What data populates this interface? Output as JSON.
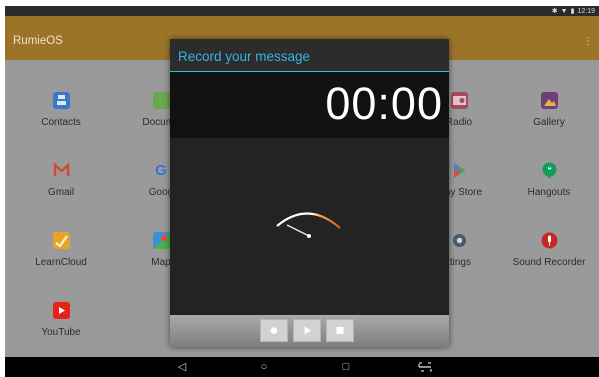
{
  "status_bar": {
    "icons": [
      "bluetooth-icon",
      "wifi-icon",
      "battery-icon"
    ],
    "time": "12:19"
  },
  "app_bar": {
    "title": "RumieOS",
    "menu_icon": "overflow-menu-icon",
    "color": "#9c7429"
  },
  "apps": [
    {
      "label": "Contacts",
      "icon": "contacts-icon"
    },
    {
      "label": "Docume",
      "icon": "documents-icon"
    },
    {
      "label": "Radio",
      "icon": "radio-icon"
    },
    {
      "label": "Gallery",
      "icon": "gallery-icon"
    },
    {
      "label": "Gmail",
      "icon": "gmail-icon"
    },
    {
      "label": "Goog",
      "icon": "google-icon"
    },
    {
      "label": "Play Store",
      "icon": "play-store-icon"
    },
    {
      "label": "Hangouts",
      "icon": "hangouts-icon"
    },
    {
      "label": "LearnCloud",
      "icon": "learncloud-icon"
    },
    {
      "label": "Map",
      "icon": "maps-icon"
    },
    {
      "label": "ttings",
      "icon": "settings-icon"
    },
    {
      "label": "Sound Recorder",
      "icon": "sound-recorder-icon"
    },
    {
      "label": "YouTube",
      "icon": "youtube-icon"
    }
  ],
  "dialog": {
    "title": "Record your message",
    "timer": "00:00",
    "level_meter_icon": "vu-meter-icon",
    "accent": "#33b5e5",
    "controls": [
      {
        "name": "record-button",
        "icon": "record-icon"
      },
      {
        "name": "play-button",
        "icon": "play-icon"
      },
      {
        "name": "stop-button",
        "icon": "stop-icon"
      }
    ]
  },
  "nav_bar": {
    "buttons": [
      "back-icon",
      "home-icon",
      "recents-icon",
      "screenshot-icon"
    ]
  }
}
